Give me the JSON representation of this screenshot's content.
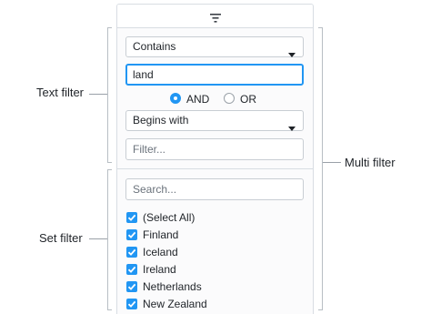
{
  "labels": {
    "text_filter": "Text filter",
    "set_filter": "Set filter",
    "multi_filter": "Multi filter"
  },
  "header": {
    "icon": "filter-icon"
  },
  "text_filter": {
    "condition1": "Contains",
    "value1": "land",
    "join_and": "AND",
    "join_or": "OR",
    "join_selected": "AND",
    "condition2": "Begins with",
    "value2_placeholder": "Filter..."
  },
  "set_filter": {
    "search_placeholder": "Search...",
    "items": [
      {
        "label": "(Select All)",
        "checked": true
      },
      {
        "label": "Finland",
        "checked": true
      },
      {
        "label": "Iceland",
        "checked": true
      },
      {
        "label": "Ireland",
        "checked": true
      },
      {
        "label": "Netherlands",
        "checked": true
      },
      {
        "label": "New Zealand",
        "checked": true
      }
    ]
  },
  "colors": {
    "accent": "#2196f3",
    "border": "#d8dde3"
  }
}
